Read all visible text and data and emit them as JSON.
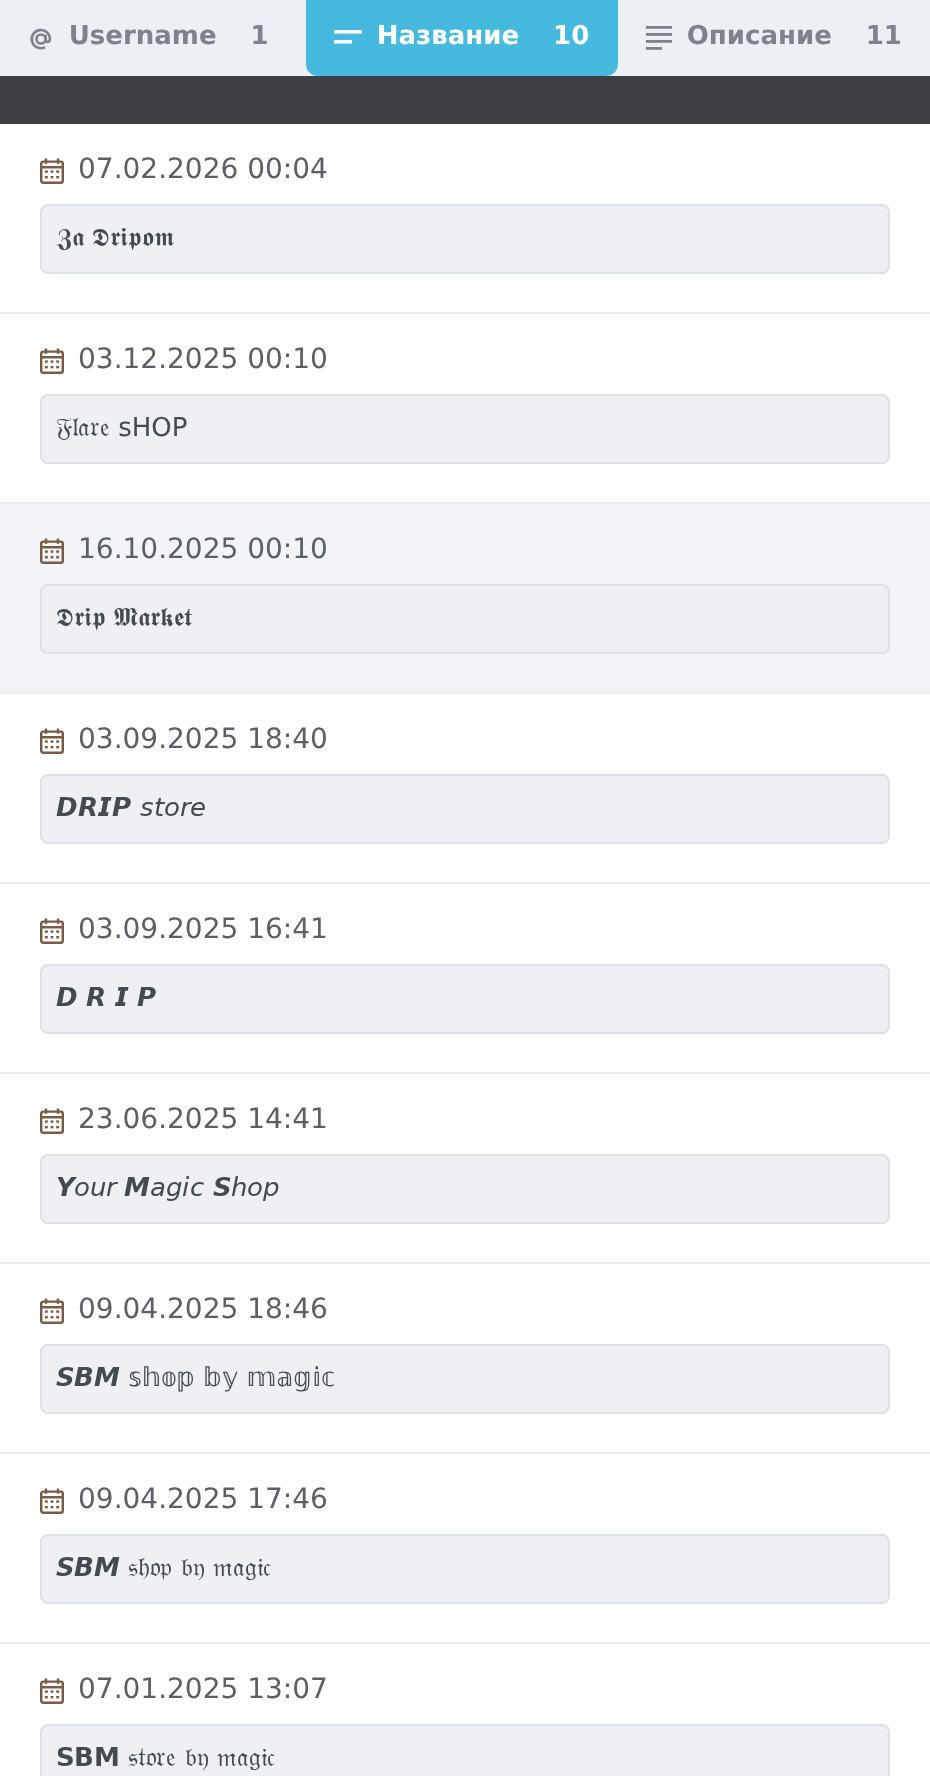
{
  "tabs": [
    {
      "kind": "at",
      "label": "Username",
      "count": "1",
      "selected": false
    },
    {
      "kind": "title",
      "label": "Название",
      "count": "10",
      "selected": true
    },
    {
      "kind": "text",
      "label": "Описание",
      "count": "11",
      "selected": false
    }
  ],
  "items": [
    {
      "date": "07.02.2026 00:04",
      "name": "𝖅𝖆 𝕯𝖗𝖎𝖕𝖔𝖒",
      "highlighted": false
    },
    {
      "date": "03.12.2025 00:10",
      "name": "𝔉𝔩𝔞𝔯𝔢 sHOP",
      "highlighted": false
    },
    {
      "date": "16.10.2025 00:10",
      "name": "𝕯𝖗𝖎𝖕 𝕸𝖆𝖗𝖐𝖊𝖙",
      "highlighted": true
    },
    {
      "date": "03.09.2025 18:40",
      "name": "𝘿𝙍𝙄𝙋 𝘴𝘵𝘰𝘳𝘦",
      "highlighted": false
    },
    {
      "date": "03.09.2025 16:41",
      "name": "𝘿 𝙍 𝙄 𝙋",
      "highlighted": false
    },
    {
      "date": "23.06.2025 14:41",
      "name": "𝙔𝘰𝘶𝘳 𝙈𝘢𝘨𝘪𝘤 𝙎𝘩𝘰𝘱",
      "highlighted": false
    },
    {
      "date": "09.04.2025 18:46",
      "name": "𝙎𝘽𝙈 𝕤𝕙𝕠𝕡 𝕓𝕪 𝕞𝕒𝕘𝕚𝕔",
      "highlighted": false
    },
    {
      "date": "09.04.2025 17:46",
      "name": "𝙎𝘽𝙈 𝔰𝔥𝔬𝔭 𝔟𝔶 𝔪𝔞𝔤𝔦𝔠",
      "highlighted": false
    },
    {
      "date": "07.01.2025 13:07",
      "name": "𝗦𝗕𝗠 𝔰𝔱𝔬𝔯𝔢 𝔟𝔶 𝔪𝔞𝔤𝔦𝔠",
      "highlighted": false
    }
  ]
}
